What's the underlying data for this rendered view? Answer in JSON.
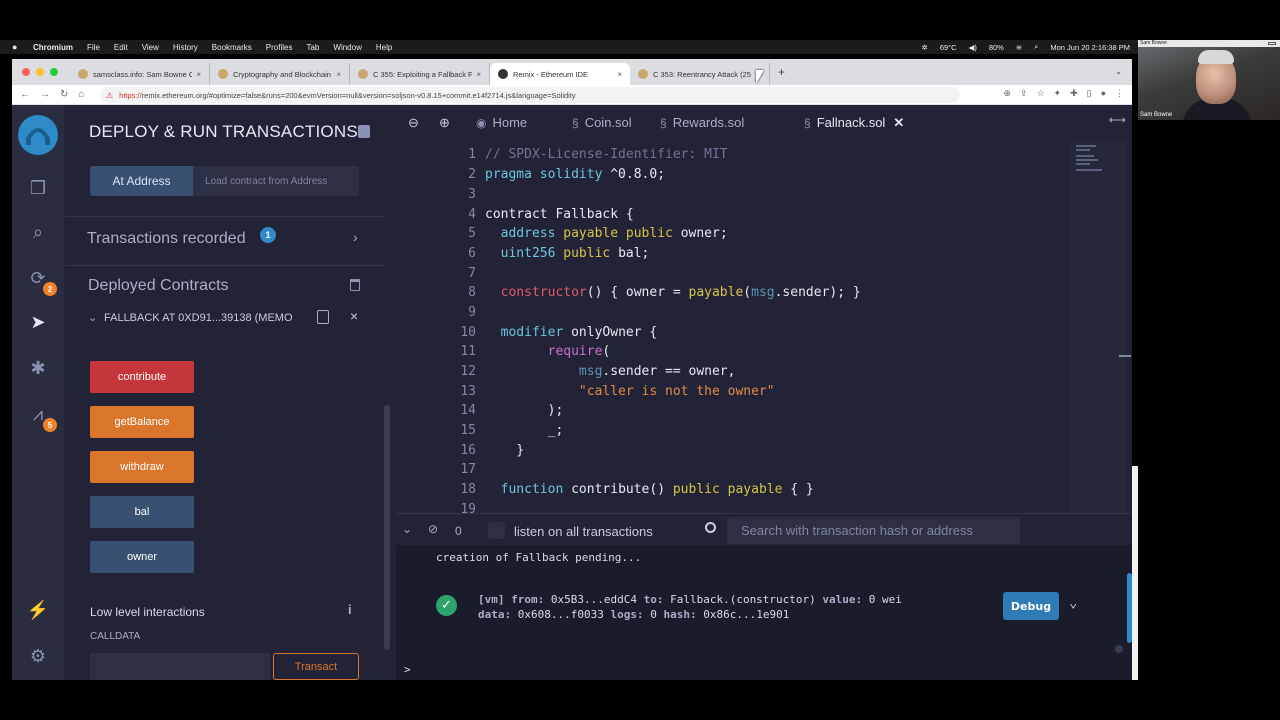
{
  "menubar": {
    "app": "Chromium",
    "items": [
      "File",
      "Edit",
      "View",
      "History",
      "Bookmarks",
      "Profiles",
      "Tab",
      "Window",
      "Help"
    ],
    "temperature": "69°C",
    "battery": "80%",
    "datetime": "Mon Jun 20  2:16:38 PM"
  },
  "webcam": {
    "bar_title": "Sam Bowne",
    "name": "Sam Bowne"
  },
  "browser": {
    "tabs": [
      {
        "title": "samsclass.info: Sam Bowne Cl"
      },
      {
        "title": "Cryptography and Blockchain"
      },
      {
        "title": "C 355: Exploiting a Fallback Fu"
      },
      {
        "title": "Remix - Ethereum IDE"
      },
      {
        "title": "C 353: Reentrancy Attack (25"
      }
    ],
    "url_scheme": "https://",
    "url_rest": "remix.ethereum.org/#optimize=false&runs=200&evmVersion=null&version=soljson-v0.8.15+commit.e14f2714.js&language=Solidity"
  },
  "iconbar": {
    "badge_compiler": "2",
    "badge_analysis": "5"
  },
  "panel": {
    "title": "DEPLOY & RUN TRANSACTIONS",
    "at_address": "At Address",
    "load_contract_placeholder": "Load contract from Address",
    "transactions_recorded": "Transactions recorded",
    "transactions_count": "1",
    "deployed_contracts": "Deployed Contracts",
    "contract_name": "FALLBACK AT 0XD91...39138 (MEMO",
    "functions": [
      {
        "label": "contribute",
        "color": "#c5363b"
      },
      {
        "label": "getBalance",
        "color": "#d9762c"
      },
      {
        "label": "withdraw",
        "color": "#d9762c"
      },
      {
        "label": "bal",
        "color": "#395170"
      },
      {
        "label": "owner",
        "color": "#395170"
      }
    ],
    "low_level": "Low level interactions",
    "calldata": "CALLDATA",
    "transact": "Transact"
  },
  "editor": {
    "tabs": [
      {
        "label": "Home",
        "icon": "home-icon"
      },
      {
        "label": "Coin.sol",
        "icon": "file-icon"
      },
      {
        "label": "Rewards.sol",
        "icon": "file-icon"
      },
      {
        "label": "Fallnack.sol",
        "icon": "file-icon"
      }
    ],
    "line_numbers": [
      "1",
      "2",
      "3",
      "4",
      "5",
      "6",
      "7",
      "8",
      "9",
      "10",
      "11",
      "12",
      "13",
      "14",
      "15",
      "16",
      "17",
      "18",
      "19"
    ]
  },
  "terminal": {
    "count": "0",
    "listen_label": "listen on all transactions",
    "search_placeholder": "Search with transaction hash or address",
    "pending": "creation of Fallback pending...",
    "tx_vm": "[vm]",
    "tx_from_label": "from:",
    "tx_from": "0x5B3...eddC4",
    "tx_to_label": "to:",
    "tx_to": "Fallback.(constructor)",
    "tx_value_label": "value:",
    "tx_value": "0 wei",
    "tx_data_label": "data:",
    "tx_data": "0x608...f0033",
    "tx_logs_label": "logs:",
    "tx_logs": "0",
    "tx_hash_label": "hash:",
    "tx_hash": "0x86c...1e901",
    "debug": "Debug",
    "prompt": ">"
  }
}
